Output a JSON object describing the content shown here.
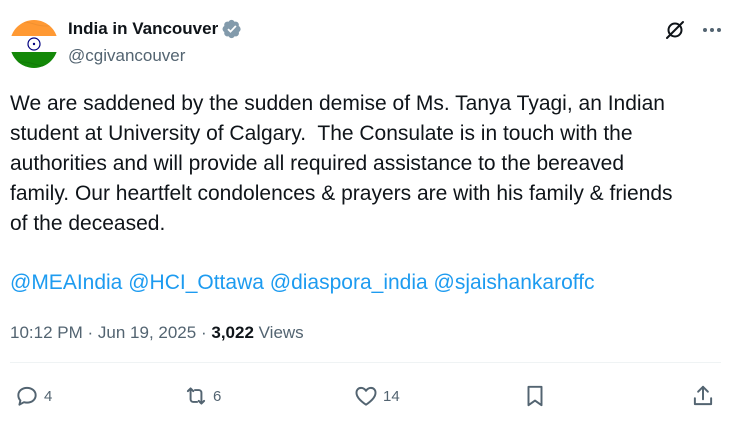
{
  "author": {
    "display_name": "India in Vancouver",
    "handle": "@cgivancouver",
    "avatar_icon": "india-flag-icon",
    "verified_icon": "verified-badge-icon"
  },
  "header_actions": {
    "grok_icon": "grok-icon",
    "more_icon": "more-options-icon"
  },
  "tweet": {
    "text": "We are saddened by the sudden demise of Ms. Tanya Tyagi, an Indian\nstudent at University of Calgary.  The Consulate is in touch with the\nauthorities and will provide all required assistance to the bereaved\nfamily. Our heartfelt condolences & prayers are with his family & friends\nof the deceased.",
    "mentions": [
      "@MEAIndia",
      "@HCI_Ottawa",
      "@diaspora_india",
      "@sjaishankaroffc"
    ]
  },
  "meta": {
    "time": "10:12 PM",
    "separator": "·",
    "date": "Jun 19, 2025",
    "views_count": "3,022",
    "views_label": "Views"
  },
  "actions": {
    "reply": {
      "icon": "reply-icon",
      "count": "4"
    },
    "retweet": {
      "icon": "retweet-icon",
      "count": "6"
    },
    "like": {
      "icon": "like-icon",
      "count": "14"
    },
    "bookmark": {
      "icon": "bookmark-icon"
    },
    "share": {
      "icon": "share-icon"
    }
  },
  "colors": {
    "text": "#0f1419",
    "secondary": "#536471",
    "link": "#1d9bf0",
    "verified": "#829aab",
    "saffron": "#ff9933",
    "green": "#138808",
    "chakra": "#000080"
  }
}
